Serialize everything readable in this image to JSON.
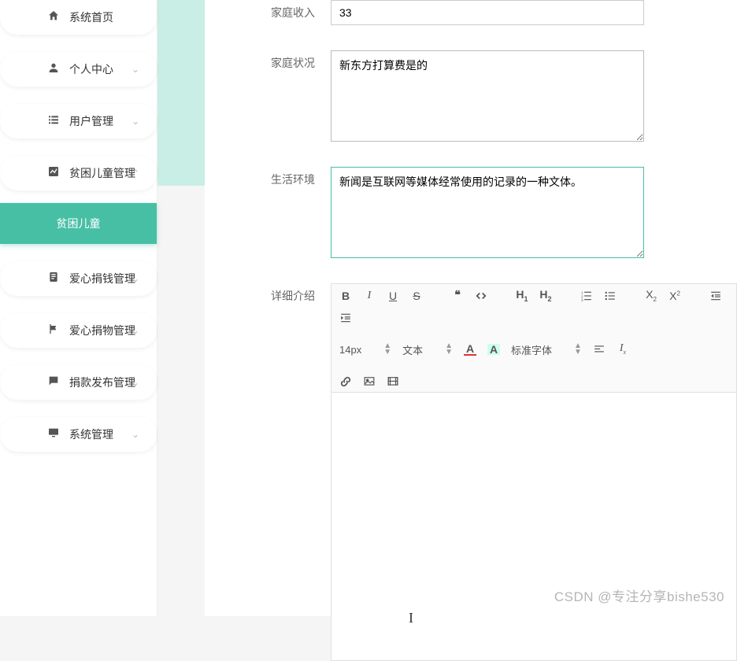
{
  "sidebar": {
    "items": [
      {
        "label": "系统首页",
        "icon": "home-icon",
        "expandable": false
      },
      {
        "label": "个人中心",
        "icon": "person-icon",
        "expandable": true,
        "open": false
      },
      {
        "label": "用户管理",
        "icon": "list-icon",
        "expandable": true,
        "open": false
      },
      {
        "label": "贫困儿童管理",
        "icon": "chart-icon",
        "expandable": true,
        "open": true
      },
      {
        "label": "爱心捐钱管理",
        "icon": "clipboard-icon",
        "expandable": true,
        "open": false
      },
      {
        "label": "爱心捐物管理",
        "icon": "flag-icon",
        "expandable": true,
        "open": false
      },
      {
        "label": "捐款发布管理",
        "icon": "chat-icon",
        "expandable": true,
        "open": false
      },
      {
        "label": "系统管理",
        "icon": "monitor-icon",
        "expandable": true,
        "open": false
      }
    ],
    "active_sub": "贫困儿童"
  },
  "form": {
    "income": {
      "label": "家庭收入",
      "value": "33"
    },
    "status": {
      "label": "家庭状况",
      "value": "新东方打算费是的"
    },
    "env": {
      "label": "生活环境",
      "value": "新闻是互联网等媒体经常使用的记录的一种文体。"
    },
    "detail": {
      "label": "详细介绍"
    }
  },
  "editor": {
    "font_size_label": "14px",
    "para_label": "文本",
    "font_family_label": "标准字体",
    "content": ""
  },
  "colors": {
    "accent": "#47bfa5"
  },
  "watermark": "CSDN @专注分享bishe530"
}
